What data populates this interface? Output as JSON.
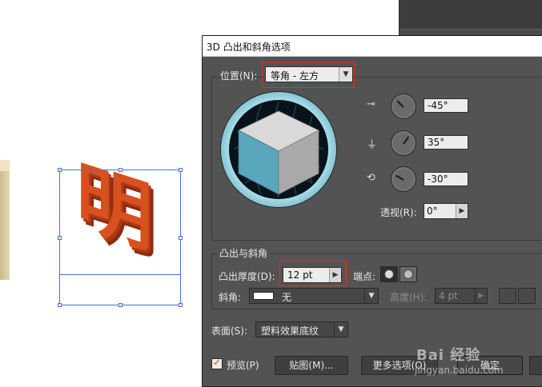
{
  "dialog": {
    "title": "3D 凸出和斜角选项",
    "position": {
      "label": "位置(N):",
      "value": "等角 - 左方",
      "rotations": [
        {
          "icon": "rotate-x-axis-icon",
          "value": "-45°"
        },
        {
          "icon": "rotate-y-axis-icon",
          "value": "35°"
        },
        {
          "icon": "rotate-z-axis-icon",
          "value": "-30°"
        }
      ],
      "perspective_label": "透视(R):",
      "perspective_value": "0°"
    },
    "extrude": {
      "group_label": "凸出与斜角",
      "depth_label": "凸出厚度(D):",
      "depth_value": "12 pt",
      "cap_label": "端点:",
      "bevel_label": "斜角:",
      "bevel_value": "无",
      "height_label": "高度(H):",
      "height_value": "4 pt"
    },
    "surface": {
      "label": "表面(S):",
      "value": "塑料效果底纹"
    },
    "footer": {
      "preview_label": "预览(P)",
      "preview_checked": true,
      "map_button": "贴图(M)...",
      "more_options_button": "更多选项(O)",
      "ok_button": "确定"
    }
  },
  "canvas": {
    "glyph": "明",
    "glyph_color": "#d9501f"
  },
  "colors": {
    "dialog_bg": "#535353",
    "highlight_box": "#e0302a",
    "selection": "#4a6ee0",
    "cube_left": "#5aa6bd",
    "cube_top": "#d9d9d9",
    "cube_right": "#a9a9a9"
  },
  "watermark": {
    "line1": "Bai 经验",
    "line2": "jingyan.baidu.com"
  }
}
